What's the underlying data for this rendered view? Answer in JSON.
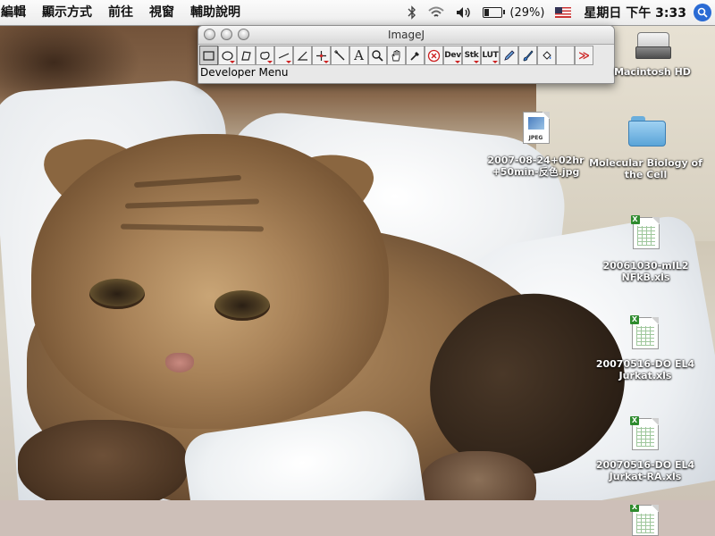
{
  "menubar": {
    "items": [
      "編輯",
      "顯示方式",
      "前往",
      "視窗",
      "輔助說明"
    ],
    "battery_percent": "(29%)",
    "battery_level": 0.29,
    "clock": "星期日 下午 3:33"
  },
  "imagej": {
    "title": "ImageJ",
    "status": "Developer Menu",
    "tools": [
      {
        "name": "rectangle-tool-icon",
        "label": "",
        "selected": true,
        "sub": false
      },
      {
        "name": "oval-tool-icon",
        "label": "",
        "selected": false,
        "sub": true
      },
      {
        "name": "polygon-tool-icon",
        "label": "",
        "selected": false,
        "sub": false
      },
      {
        "name": "freehand-tool-icon",
        "label": "",
        "selected": false,
        "sub": true
      },
      {
        "name": "line-tool-icon",
        "label": "",
        "selected": false,
        "sub": true
      },
      {
        "name": "angle-tool-icon",
        "label": "",
        "selected": false,
        "sub": false
      },
      {
        "name": "point-tool-icon",
        "label": "",
        "selected": false,
        "sub": true
      },
      {
        "name": "wand-tool-icon",
        "label": "",
        "selected": false,
        "sub": false
      },
      {
        "name": "text-tool-icon",
        "label": "A",
        "selected": false,
        "sub": false
      },
      {
        "name": "magnifier-tool-icon",
        "label": "",
        "selected": false,
        "sub": false
      },
      {
        "name": "hand-tool-icon",
        "label": "",
        "selected": false,
        "sub": false
      },
      {
        "name": "dropper-tool-icon",
        "label": "",
        "selected": false,
        "sub": false
      },
      {
        "name": "stop-tool-icon",
        "label": "",
        "selected": false,
        "sub": false
      },
      {
        "name": "dev-tool-icon",
        "label": "Dev",
        "selected": false,
        "sub": true
      },
      {
        "name": "stk-tool-icon",
        "label": "Stk",
        "selected": false,
        "sub": true
      },
      {
        "name": "lut-tool-icon",
        "label": "LUT",
        "selected": false,
        "sub": true
      },
      {
        "name": "pencil-tool-icon",
        "label": "",
        "selected": false,
        "sub": false
      },
      {
        "name": "brush-tool-icon",
        "label": "",
        "selected": false,
        "sub": false
      },
      {
        "name": "flood-fill-tool-icon",
        "label": "",
        "selected": false,
        "sub": false
      },
      {
        "name": "empty-tool-slot",
        "label": "",
        "selected": false,
        "sub": false
      },
      {
        "name": "more-tools-icon",
        "label": "≫",
        "selected": false,
        "sub": false
      }
    ]
  },
  "desktop": {
    "icons": [
      {
        "kind": "harddisk",
        "name": "macintosh-hd-icon",
        "label": "Macintosh HD"
      },
      {
        "kind": "jpeg",
        "name": "jpeg-file-icon",
        "badge": "JPEG",
        "label": "2007-08-24+02hr\n+50min-反色.jpg"
      },
      {
        "kind": "folder",
        "name": "folder-icon",
        "label": "Molecular Biology of\nthe Cell"
      },
      {
        "kind": "xls",
        "name": "xls-file-icon",
        "badge": "X",
        "label": "20061030-mIL2\nNFkB.xls"
      },
      {
        "kind": "xls",
        "name": "xls-file-icon",
        "badge": "X",
        "label": "20070516-DO EL4\nJurkat.xls"
      },
      {
        "kind": "xls",
        "name": "xls-file-icon",
        "badge": "X",
        "label": "20070516-DO EL4\nJurkat-RA.xls"
      },
      {
        "kind": "xls",
        "name": "xls-file-icon",
        "badge": "X",
        "label": ""
      }
    ]
  },
  "colors": {
    "accent_red": "#cc2222",
    "spotlight_blue": "#2a6bd4"
  }
}
